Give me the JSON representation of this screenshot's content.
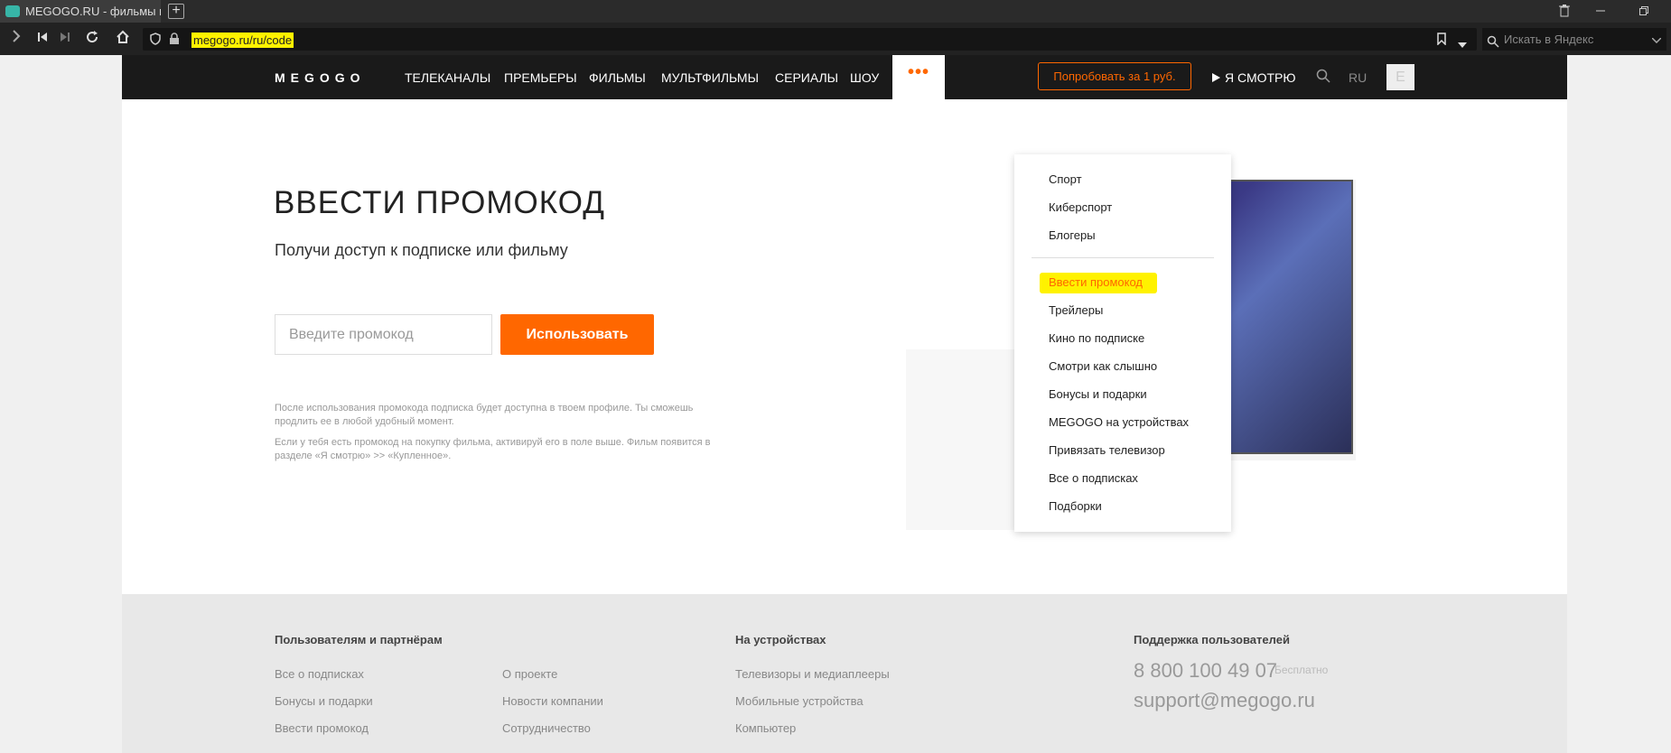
{
  "browser": {
    "tab_title": "MEGOGO.RU - фильмы и т",
    "new_tab_symbol": "+",
    "url": "megogo.ru/ru/code",
    "search_placeholder": "Искать в Яндекс"
  },
  "header": {
    "logo": "MEGOGO",
    "nav": [
      "ТЕЛЕКАНАЛЫ",
      "ПРЕМЬЕРЫ",
      "ФИЛЬМЫ",
      "МУЛЬТФИЛЬМЫ",
      "СЕРИАЛЫ",
      "ШОУ"
    ],
    "more": "•••",
    "try_button": "Попробовать за 1 руб.",
    "watch_link": "Я СМОТРЮ",
    "lang": "RU",
    "avatar_letter": "E"
  },
  "main": {
    "title": "ВВЕСТИ ПРОМОКОД",
    "subtitle": "Получи доступ к подписке или фильму",
    "input_placeholder": "Введите промокод",
    "use_button": "Использовать",
    "note1": "После использования промокода подписка будет доступна в твоем профиле. Ты сможешь продлить ее в любой удобный момент.",
    "note2": "Если у тебя есть промокод на покупку фильма, активируй его в поле выше. Фильм появится в разделе «Я смотрю» >> «Купленное»."
  },
  "dropdown": {
    "group1": [
      "Спорт",
      "Киберспорт",
      "Блогеры"
    ],
    "group2": [
      "Ввести промокод",
      "Трейлеры",
      "Кино по подписке",
      "Смотри как слышно",
      "Бонусы и подарки",
      "MEGOGO на устройствах",
      "Привязать телевизор",
      "Все о подписках",
      "Подборки"
    ],
    "highlight_color": "#fff200"
  },
  "footer": {
    "col1_title": "Пользователям и партнёрам",
    "col1_links_a": [
      "Все о подписках",
      "Бонусы и подарки",
      "Ввести промокод"
    ],
    "col1_links_b": [
      "О проекте",
      "Новости компании",
      "Сотрудничество"
    ],
    "col2_title": "На устройствах",
    "col2_links": [
      "Телевизоры и медиаплееры",
      "Мобильные устройства",
      "Компьютер"
    ],
    "col3_title": "Поддержка пользователей",
    "phone": "8 800 100 49 07",
    "phone_note": "Бесплатно",
    "email": "support@megogo.ru"
  },
  "colors": {
    "accent": "#ff6700",
    "header_bg": "#1a1a1a"
  }
}
